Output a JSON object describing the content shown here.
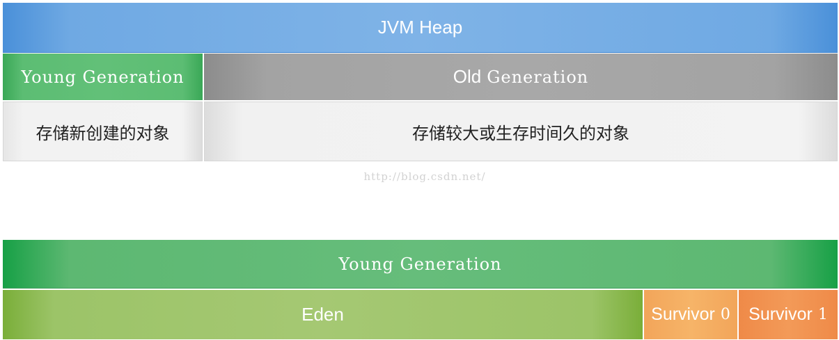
{
  "heap_diagram": {
    "heap_label": "JVM Heap",
    "young_generation_label": "Young Generation",
    "old_generation_word1": "Old",
    "old_generation_word2": "Generation",
    "young_description": "存储新创建的对象",
    "old_description": "存储较大或生存时间久的对象"
  },
  "watermark": "http://blog.csdn.net/",
  "young_diagram": {
    "young_generation_label": "Young Generation",
    "eden_label": "Eden",
    "survivor0_word": "Survivor",
    "survivor0_num": "0",
    "survivor1_word": "Survivor",
    "survivor1_num": "1"
  },
  "colors": {
    "heap": "#7fb3e7",
    "young_generation": "#62c078",
    "old_generation": "#a8a8a8",
    "description": "#f3f3f3",
    "eden": "#a5c873",
    "survivor0": "#f6b468",
    "survivor1": "#f39a58"
  }
}
